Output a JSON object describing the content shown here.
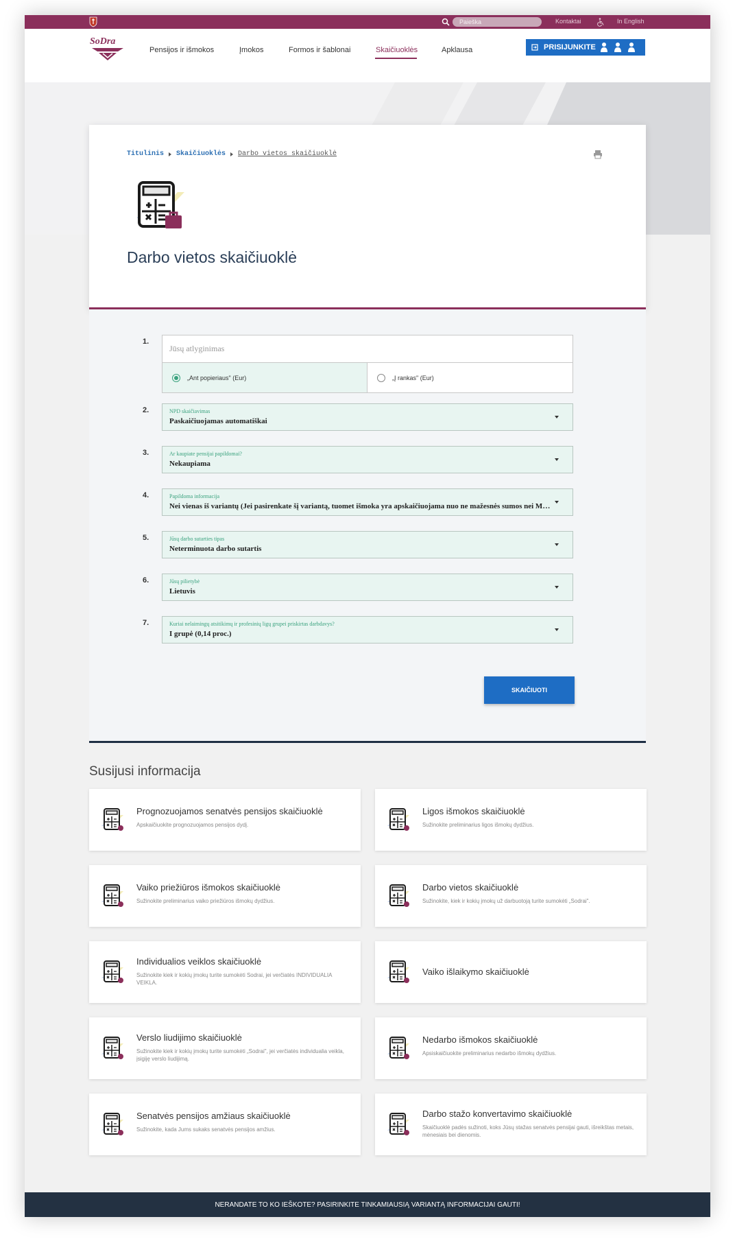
{
  "topbar": {
    "search_placeholder": "Paieška",
    "contacts": "Kontaktai",
    "english": "In English"
  },
  "nav": {
    "items": [
      "Pensijos ir išmokos",
      "Įmokos",
      "Formos ir šablonai",
      "Skaičiuoklės",
      "Apklausa"
    ],
    "active_index": 3,
    "login": "PRISIJUNKITE"
  },
  "brand": {
    "logo_text": "SoDra",
    "primary": "#8b2f5b",
    "accent": "#1e6dc4",
    "dark": "#233142",
    "field_bg": "#e8f5f1",
    "field_label": "#3aa27e"
  },
  "breadcrumb": [
    "Titulinis",
    "Skaičiuoklės",
    "Darbo vietos skaičiuoklė"
  ],
  "page_title": "Darbo vietos skaičiuoklė",
  "form": {
    "numbers": [
      "1.",
      "2.",
      "3.",
      "4.",
      "5.",
      "6.",
      "7."
    ],
    "salary_placeholder": "Jūsų atlyginimas",
    "radio_gross": "„Ant popieriaus\" (Eur)",
    "radio_net": "„Į rankas\" (Eur)",
    "selected_radio": "gross",
    "selects": [
      {
        "label": "NPD skaičiavimas",
        "value": "Paskaičiuojamas automatiškai"
      },
      {
        "label": "Ar kaupiate pensijai papildomai?",
        "value": "Nekaupiama"
      },
      {
        "label": "Papildoma informacija",
        "value": "Nei vienas iš variantų (Jei pasirenkate šį variantą, tuomet išmoka yra apskaičiuojama nuo ne mažesnės sumos nei MMA)"
      },
      {
        "label": "Jūsų darbo sutarties tipas",
        "value": "Neterminuota darbo sutartis"
      },
      {
        "label": "Jūsų pilietybė",
        "value": "Lietuvis"
      },
      {
        "label": "Kuriai nelaimingų atsitikimų ir profesinių ligų grupei priskirtas darbdavys?",
        "value": "I grupė (0,14 proc.)"
      }
    ],
    "submit": "SKAIČIUOTI"
  },
  "related": {
    "title": "Susijusi informacija",
    "cards": [
      {
        "title": "Prognozuojamos senatvės pensijos skaičiuoklė",
        "desc": "Apskaičiuokite prognozuojamos pensijos dydį.",
        "icon": "calculator-clock-icon"
      },
      {
        "title": "Ligos išmokos skaičiuoklė",
        "desc": "Sužinokite preliminarius ligos išmokų dydžius.",
        "icon": "calculator-pill-icon"
      },
      {
        "title": "Vaiko priežiūros išmokos skaičiuoklė",
        "desc": "Sužinokite preliminarius vaiko priežiūros išmokų dydžius.",
        "icon": "calculator-stroller-icon"
      },
      {
        "title": "Darbo vietos skaičiuoklė",
        "desc": "Sužinokite, kiek ir kokių įmokų už darbuotoją turite sumokėti „Sodrai\".",
        "icon": "calculator-briefcase-icon"
      },
      {
        "title": "Individualios veiklos skaičiuoklė",
        "desc": "Sužinokite kiek ir kokių įmokų turite sumokėti Sodrai, jei verčiatės INDIVIDUALIA VEIKLA.",
        "icon": "calculator-tool-icon"
      },
      {
        "title": "Vaiko išlaikymo skaičiuoklė",
        "desc": "",
        "icon": "calculator-child-icon"
      },
      {
        "title": "Verslo liudijimo skaičiuoklė",
        "desc": "Sužinokite kiek ir kokių įmokų turite sumokėti „Sodrai\", jei verčiatės individualia veikla, įsigiję verslo liudijimą.",
        "icon": "calculator-document-icon"
      },
      {
        "title": "Nedarbo išmokos skaičiuoklė",
        "desc": "Apsiskaičiuokite preliminarius nedarbo išmokų dydžius.",
        "icon": "calculator-doc-icon"
      },
      {
        "title": "Senatvės pensijos amžiaus skaičiuoklė",
        "desc": "Sužinokite, kada Jums sukaks senatvės pensijos amžius.",
        "icon": "calculator-timer-icon"
      },
      {
        "title": "Darbo stažo konvertavimo skaičiuoklė",
        "desc": "Skaičiuoklė padės sužinoti, koks Jūsų stažas senatvės pensijai gauti, išreikštas metais, mėnesiais bei dienomis.",
        "icon": "calculator-pen-icon"
      }
    ]
  },
  "footer": "NERANDATE TO KO IEŠKOTE? PASIRINKITE TINKAMIAUSIĄ VARIANTĄ INFORMACIJAI GAUTI!"
}
